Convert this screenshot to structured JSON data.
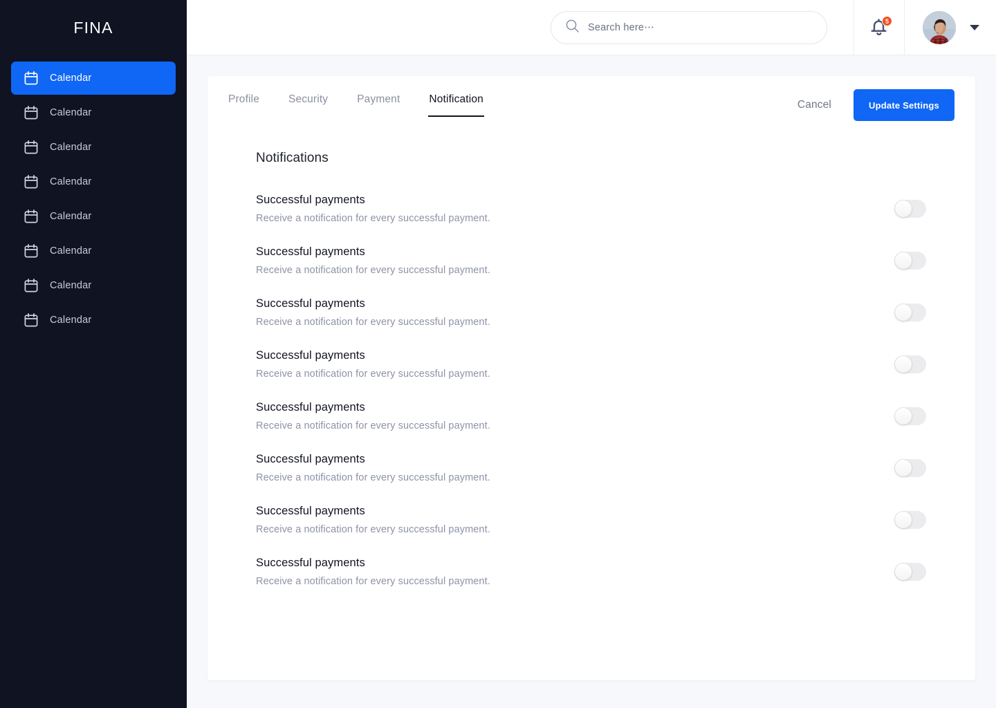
{
  "theme": {
    "accent": "#1066f5",
    "sidebar_bg": "#0f1322",
    "page_bg": "#f7f8fb",
    "card_bg": "#ffffff",
    "badge_color": "#f4511e",
    "muted_text": "#8e93a6",
    "toggle_off": "#ececee"
  },
  "sidebar": {
    "brand": "FINA",
    "items": [
      {
        "label": "Calendar",
        "icon": "calendar-icon",
        "active": true
      },
      {
        "label": "Calendar",
        "icon": "calendar-icon",
        "active": false
      },
      {
        "label": "Calendar",
        "icon": "calendar-icon",
        "active": false
      },
      {
        "label": "Calendar",
        "icon": "calendar-icon",
        "active": false
      },
      {
        "label": "Calendar",
        "icon": "calendar-icon",
        "active": false
      },
      {
        "label": "Calendar",
        "icon": "calendar-icon",
        "active": false
      },
      {
        "label": "Calendar",
        "icon": "calendar-icon",
        "active": false
      },
      {
        "label": "Calendar",
        "icon": "calendar-icon",
        "active": false
      }
    ]
  },
  "topbar": {
    "search": {
      "icon": "search-icon",
      "value": "",
      "placeholder": "Search here⋯"
    },
    "notifications": {
      "icon": "bell-icon",
      "badge_count": "5"
    },
    "user": {
      "avatar": "avatar",
      "caret": "chevron-down-icon"
    }
  },
  "card": {
    "tabs": [
      {
        "label": "Profile",
        "active": false
      },
      {
        "label": "Security",
        "active": false
      },
      {
        "label": "Payment",
        "active": false
      },
      {
        "label": "Notification",
        "active": true
      }
    ],
    "actions": {
      "cancel_label": "Cancel",
      "update_label": "Update Settings"
    },
    "section_title": "Notifications",
    "rows": [
      {
        "title": "Successful payments",
        "desc": "Receive a notification for every successful payment.",
        "enabled": false
      },
      {
        "title": "Successful payments",
        "desc": "Receive a notification for every successful payment.",
        "enabled": false
      },
      {
        "title": "Successful payments",
        "desc": "Receive a notification for every successful payment.",
        "enabled": false
      },
      {
        "title": "Successful payments",
        "desc": "Receive a notification for every successful payment.",
        "enabled": false
      },
      {
        "title": "Successful payments",
        "desc": "Receive a notification for every successful payment.",
        "enabled": false
      },
      {
        "title": "Successful payments",
        "desc": "Receive a notification for every successful payment.",
        "enabled": false
      },
      {
        "title": "Successful payments",
        "desc": "Receive a notification for every successful payment.",
        "enabled": false
      },
      {
        "title": "Successful payments",
        "desc": "Receive a notification for every successful payment.",
        "enabled": false
      }
    ]
  }
}
